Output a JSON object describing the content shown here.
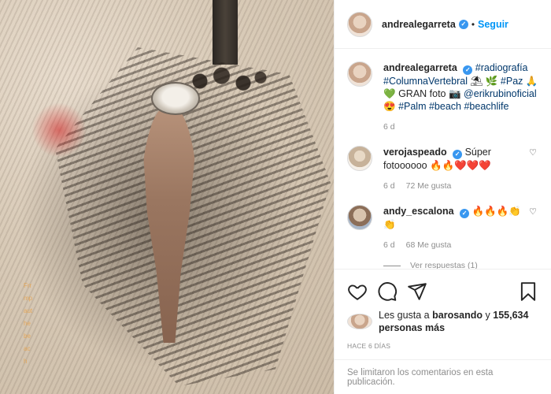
{
  "post": {
    "author": "andrealegarreta",
    "follow_label": "Seguir",
    "dot": "•",
    "caption": {
      "username": "andrealegarreta",
      "text_parts": [
        "#radiografía",
        "#ColumnaVertebral",
        "⛱",
        "🌿",
        "#Paz",
        "🙏",
        "💚",
        "GRAN foto",
        "📷",
        "@erikrubinoficial",
        "😍",
        "#Palm",
        "#beach",
        "#beachlife"
      ],
      "age": "6 d"
    },
    "comments": [
      {
        "username": "verojaspeado",
        "text": "Súper fotoooooo 🔥🔥❤️❤️❤️",
        "age": "6 d",
        "likes": "72 Me gusta"
      },
      {
        "username": "andy_escalona",
        "text": "🔥🔥🔥👏👏",
        "age": "6 d",
        "likes": "68 Me gusta",
        "replies": "Ver respuestas (1)"
      }
    ],
    "likes_line": {
      "prefix": "Les gusta a",
      "liker": "barosando",
      "connector": "y",
      "count": "155,634 personas más"
    },
    "posted_time": "HACE 6 DÍAS",
    "comments_disabled": "Se limitaron los comentarios en esta publicación."
  },
  "photo": {
    "vertical_text": "Frrmpauthebeach"
  },
  "icons": {
    "verified": "verified-badge-icon",
    "heart": "heart-icon",
    "comment": "comment-icon",
    "share": "share-icon",
    "save": "bookmark-icon"
  },
  "colors": {
    "link": "#0095f6",
    "hashtag": "#00376b",
    "muted": "#8e8e8e",
    "verified": "#3897f0"
  }
}
